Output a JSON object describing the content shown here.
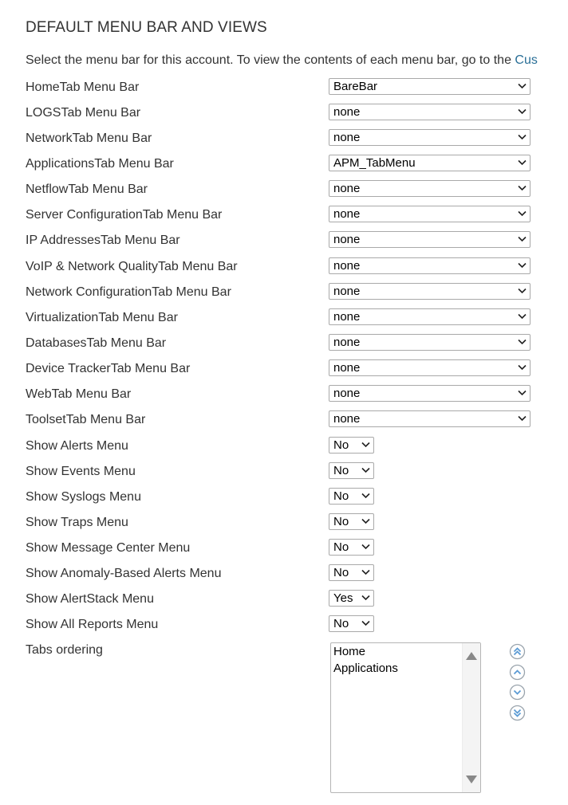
{
  "section": {
    "title": "DEFAULT MENU BAR AND VIEWS",
    "intro_text": "Select the menu bar for this account. To view the contents of each menu bar, go to the ",
    "intro_link": "Cus"
  },
  "menu_bars": [
    {
      "label": "HomeTab Menu Bar",
      "value": "BareBar"
    },
    {
      "label": "LOGSTab Menu Bar",
      "value": "none"
    },
    {
      "label": "NetworkTab Menu Bar",
      "value": "none"
    },
    {
      "label": "ApplicationsTab Menu Bar",
      "value": "APM_TabMenu"
    },
    {
      "label": "NetflowTab Menu Bar",
      "value": "none"
    },
    {
      "label": "Server ConfigurationTab Menu Bar",
      "value": "none"
    },
    {
      "label": "IP AddressesTab Menu Bar",
      "value": "none"
    },
    {
      "label": "VoIP & Network QualityTab Menu Bar",
      "value": "none"
    },
    {
      "label": "Network ConfigurationTab Menu Bar",
      "value": "none"
    },
    {
      "label": "VirtualizationTab Menu Bar",
      "value": "none"
    },
    {
      "label": "DatabasesTab Menu Bar",
      "value": "none"
    },
    {
      "label": "Device TrackerTab Menu Bar",
      "value": "none"
    },
    {
      "label": "WebTab Menu Bar",
      "value": "none"
    },
    {
      "label": "ToolsetTab Menu Bar",
      "value": "none"
    }
  ],
  "show_menus": [
    {
      "label": "Show Alerts Menu",
      "value": "No"
    },
    {
      "label": "Show Events Menu",
      "value": "No"
    },
    {
      "label": "Show Syslogs Menu",
      "value": "No"
    },
    {
      "label": "Show Traps Menu",
      "value": "No"
    },
    {
      "label": "Show Message Center Menu",
      "value": "No"
    },
    {
      "label": "Show Anomaly-Based Alerts Menu",
      "value": "No"
    },
    {
      "label": "Show AlertStack Menu",
      "value": "Yes"
    },
    {
      "label": "Show All Reports Menu",
      "value": "No"
    }
  ],
  "tabs_ordering": {
    "label": "Tabs ordering",
    "items": [
      "Home",
      "Applications"
    ],
    "buttons": [
      {
        "name": "move-top",
        "icon": "double-chevron-up-icon"
      },
      {
        "name": "move-up",
        "icon": "chevron-up-icon"
      },
      {
        "name": "move-down",
        "icon": "chevron-down-icon"
      },
      {
        "name": "move-bottom",
        "icon": "double-chevron-down-icon"
      }
    ]
  },
  "colors": {
    "text": "#333333",
    "link": "#2a6f97",
    "order_button": "#5b9bd5"
  }
}
